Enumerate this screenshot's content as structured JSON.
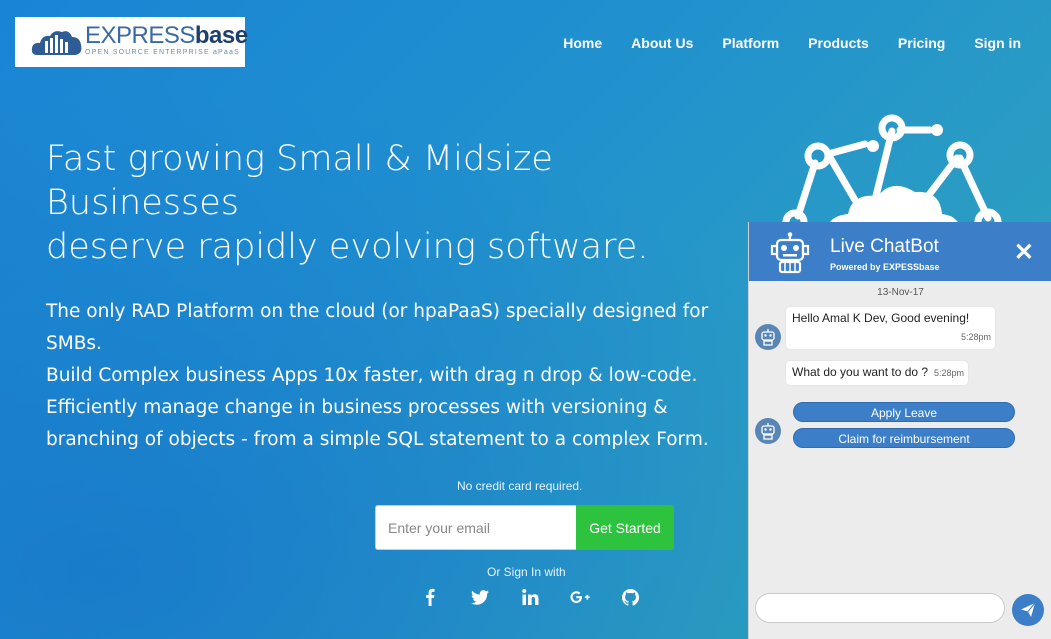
{
  "logo": {
    "main_light": "EXPRESS",
    "main_bold": "base",
    "tagline": "OPEN SOURCE ENTERPRISE aPaaS"
  },
  "nav": [
    {
      "label": "Home"
    },
    {
      "label": "About Us"
    },
    {
      "label": "Platform"
    },
    {
      "label": "Products"
    },
    {
      "label": "Pricing"
    },
    {
      "label": "Sign in"
    }
  ],
  "hero": {
    "headline": [
      "Fast growing Small & Midsize",
      "Businesses",
      "deserve rapidly evolving software."
    ],
    "lead": [
      "The only RAD Platform on the cloud (or hpaPaaS) specially designed for",
      "SMBs.",
      "Build Complex business Apps 10x faster, with drag n drop & low-code.",
      "Efficiently manage change in business processes with versioning &",
      "branching of objects - from a simple SQL statement to a complex Form."
    ],
    "no_card": "No credit card required.",
    "email_placeholder": "Enter your email",
    "cta": "Get Started",
    "or_sign_in": "Or Sign In with",
    "social_icons": [
      "facebook-icon",
      "twitter-icon",
      "linkedin-icon",
      "google-plus-icon",
      "github-icon"
    ]
  },
  "chat": {
    "title": "Live ChatBot",
    "subtitle": "Powered by EXPESSbase",
    "close": "✕",
    "date": "13-Nov-17",
    "messages": [
      {
        "text": "Hello Amal K Dev, Good evening!",
        "time": "5:28pm"
      },
      {
        "text": "What do you want to do ?",
        "time": "5:28pm"
      }
    ],
    "options": [
      "Apply Leave",
      "Claim for reimbursement"
    ]
  },
  "colors": {
    "accent": "#3c7ec7",
    "cta_green": "#2ec33f"
  }
}
